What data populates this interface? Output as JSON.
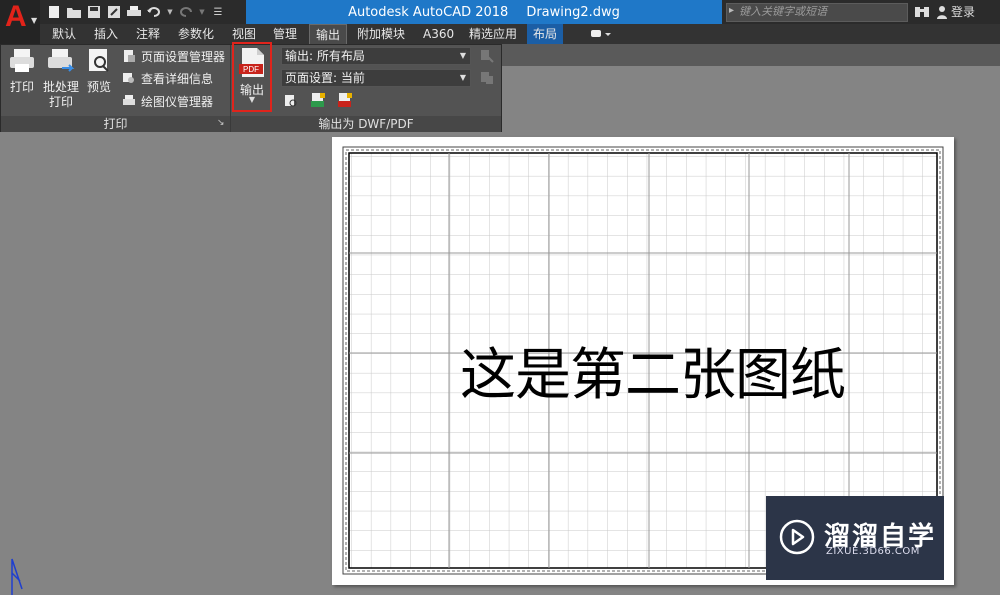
{
  "title_bar": {
    "app_name": "Autodesk AutoCAD 2018",
    "document": "Drawing2.dwg",
    "search_placeholder": "键入关键字或短语",
    "login_label": "登录"
  },
  "tabs": [
    "默认",
    "插入",
    "注释",
    "参数化",
    "视图",
    "管理",
    "输出",
    "附加模块",
    "A360",
    "精选应用",
    "布局"
  ],
  "active_tab": "输出",
  "ribbon": {
    "print_panel": {
      "label": "打印",
      "buttons": {
        "print": "打印",
        "batch_print_1": "批处理",
        "batch_print_2": "打印",
        "preview": "预览"
      },
      "small_buttons": {
        "page_setup_manager": "页面设置管理器",
        "view_details": "查看详细信息",
        "plotter_manager": "绘图仪管理器"
      }
    },
    "export_panel": {
      "label": "输出为 DWF/PDF",
      "export_button": "输出",
      "pdf_icon_text": "PDF",
      "export_combo": "输出: 所有布局",
      "page_setup_combo": "页面设置: 当前"
    }
  },
  "drawing": {
    "title_text": "这是第二张图纸"
  },
  "watermark": {
    "name": "溜溜自学",
    "url": "ZIXUE.3D66.COM"
  },
  "colors": {
    "accent_blue": "#1f78c8",
    "highlight_red": "#e0241c",
    "logo_red": "#e2231a"
  }
}
